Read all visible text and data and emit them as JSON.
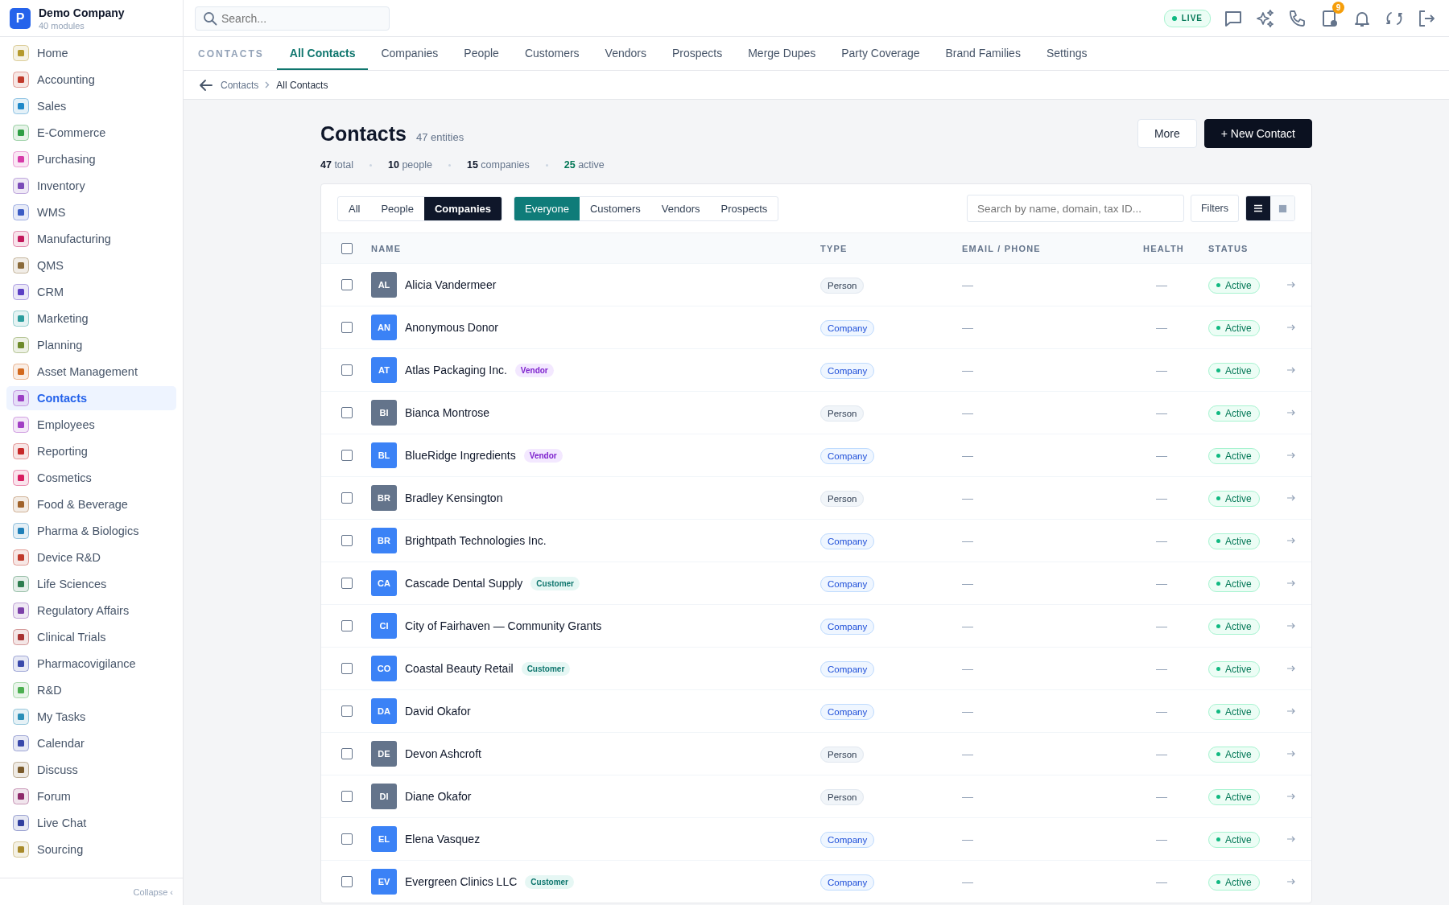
{
  "company": {
    "logo": "P",
    "name": "Demo Company",
    "subtitle": "40 modules"
  },
  "sidebar": {
    "items": [
      {
        "label": "Home",
        "color": "#b59a2e",
        "selected": false
      },
      {
        "label": "Accounting",
        "color": "#c0392b",
        "selected": false
      },
      {
        "label": "Sales",
        "color": "#1e88c8",
        "selected": false
      },
      {
        "label": "E-Commerce",
        "color": "#2e9e44",
        "selected": false
      },
      {
        "label": "Purchasing",
        "color": "#d63aa8",
        "selected": false
      },
      {
        "label": "Inventory",
        "color": "#7b4bb8",
        "selected": false
      },
      {
        "label": "WMS",
        "color": "#3b5cc4",
        "selected": false
      },
      {
        "label": "Manufacturing",
        "color": "#c2185b",
        "selected": false
      },
      {
        "label": "QMS",
        "color": "#8a6a3a",
        "selected": false
      },
      {
        "label": "CRM",
        "color": "#5b3fc4",
        "selected": false
      },
      {
        "label": "Marketing",
        "color": "#2a9d9d",
        "selected": false
      },
      {
        "label": "Planning",
        "color": "#6d8a2a",
        "selected": false
      },
      {
        "label": "Asset Management",
        "color": "#d2691e",
        "selected": false
      },
      {
        "label": "Contacts",
        "color": "#9b3fc4",
        "selected": true
      },
      {
        "label": "Employees",
        "color": "#a23fc4",
        "selected": false
      },
      {
        "label": "Reporting",
        "color": "#c62828",
        "selected": false
      },
      {
        "label": "Cosmetics",
        "color": "#d81b60",
        "selected": false
      },
      {
        "label": "Food & Beverage",
        "color": "#a0622a",
        "selected": false
      },
      {
        "label": "Pharma & Biologics",
        "color": "#1e7fb8",
        "selected": false
      },
      {
        "label": "Device R&D",
        "color": "#c0392b",
        "selected": false
      },
      {
        "label": "Life Sciences",
        "color": "#2e7d4f",
        "selected": false
      },
      {
        "label": "Regulatory Affairs",
        "color": "#7b3fa8",
        "selected": false
      },
      {
        "label": "Clinical Trials",
        "color": "#a83232",
        "selected": false
      },
      {
        "label": "Pharmacovigilance",
        "color": "#3949ab",
        "selected": false
      },
      {
        "label": "R&D",
        "color": "#4caf50",
        "selected": false
      },
      {
        "label": "My Tasks",
        "color": "#2a8fb8",
        "selected": false
      },
      {
        "label": "Calendar",
        "color": "#3949ab",
        "selected": false
      },
      {
        "label": "Discuss",
        "color": "#7a5a2a",
        "selected": false
      },
      {
        "label": "Forum",
        "color": "#8e2a6a",
        "selected": false
      },
      {
        "label": "Live Chat",
        "color": "#303f9f",
        "selected": false
      },
      {
        "label": "Sourcing",
        "color": "#a88a2a",
        "selected": false
      }
    ],
    "collapse": "Collapse ‹"
  },
  "topbar": {
    "search": {
      "placeholder": "Search..."
    },
    "live": "LIVE",
    "badge": "9"
  },
  "module_nav": {
    "title": "CONTACTS",
    "tabs": [
      {
        "label": "All Contacts",
        "selected": true
      },
      {
        "label": "Companies",
        "selected": false
      },
      {
        "label": "People",
        "selected": false
      },
      {
        "label": "Customers",
        "selected": false
      },
      {
        "label": "Vendors",
        "selected": false
      },
      {
        "label": "Prospects",
        "selected": false
      },
      {
        "label": "Merge Dupes",
        "selected": false
      },
      {
        "label": "Party Coverage",
        "selected": false
      },
      {
        "label": "Brand Families",
        "selected": false
      },
      {
        "label": "Settings",
        "selected": false
      }
    ]
  },
  "breadcrumb": [
    "Contacts",
    "All Contacts"
  ],
  "header": {
    "title": "Contacts",
    "count": "47 entities",
    "buttons": [
      "More",
      "+ New Contact"
    ]
  },
  "stats": [
    {
      "value": "47",
      "label": "total",
      "kind": "plain"
    },
    {
      "value": "10",
      "label": "people",
      "kind": "plain"
    },
    {
      "value": "15",
      "label": "companies",
      "kind": "plain"
    },
    {
      "value": "25",
      "label": "active",
      "kind": "good"
    }
  ],
  "filters": {
    "entity": [
      {
        "label": "All",
        "selected": false
      },
      {
        "label": "People",
        "selected": false
      },
      {
        "label": "Companies",
        "selected": true
      }
    ],
    "role": [
      {
        "label": "Everyone",
        "selected": true
      },
      {
        "label": "Customers",
        "selected": false
      },
      {
        "label": "Vendors",
        "selected": false
      },
      {
        "label": "Prospects",
        "selected": false
      }
    ],
    "search": {
      "placeholder": "Search by name, domain, tax ID..."
    },
    "filters_button": "Filters",
    "view": [
      {
        "kind": "list",
        "selected": true
      },
      {
        "kind": "grid",
        "selected": false
      }
    ]
  },
  "table": {
    "select_all": false,
    "columns": [
      "NAME",
      "TYPE",
      "EMAIL / PHONE",
      "HEALTH",
      "STATUS"
    ],
    "rows": [
      {
        "initials": "AL",
        "name": "Alicia Vandermeer",
        "tag": null,
        "type": "Person",
        "kind": "person",
        "email": "—",
        "health": "—",
        "status": "Active",
        "checked": false
      },
      {
        "initials": "AN",
        "name": "Anonymous Donor",
        "tag": null,
        "type": "Company",
        "kind": "company",
        "email": "—",
        "health": "—",
        "status": "Active",
        "checked": false
      },
      {
        "initials": "AT",
        "name": "Atlas Packaging Inc.",
        "tag": {
          "label": "Vendor",
          "kind": "vendor"
        },
        "type": "Company",
        "kind": "company",
        "email": "—",
        "health": "—",
        "status": "Active",
        "checked": false
      },
      {
        "initials": "BI",
        "name": "Bianca Montrose",
        "tag": null,
        "type": "Person",
        "kind": "person",
        "email": "—",
        "health": "—",
        "status": "Active",
        "checked": false
      },
      {
        "initials": "BL",
        "name": "BlueRidge Ingredients",
        "tag": {
          "label": "Vendor",
          "kind": "vendor"
        },
        "type": "Company",
        "kind": "company",
        "email": "—",
        "health": "—",
        "status": "Active",
        "checked": false
      },
      {
        "initials": "BR",
        "name": "Bradley Kensington",
        "tag": null,
        "type": "Person",
        "kind": "person",
        "email": "—",
        "health": "—",
        "status": "Active",
        "checked": false
      },
      {
        "initials": "BR",
        "name": "Brightpath Technologies Inc.",
        "tag": null,
        "type": "Company",
        "kind": "company",
        "email": "—",
        "health": "—",
        "status": "Active",
        "checked": false
      },
      {
        "initials": "CA",
        "name": "Cascade Dental Supply",
        "tag": {
          "label": "Customer",
          "kind": "customer"
        },
        "type": "Company",
        "kind": "company",
        "email": "—",
        "health": "—",
        "status": "Active",
        "checked": false
      },
      {
        "initials": "CI",
        "name": "City of Fairhaven — Community Grants",
        "tag": null,
        "type": "Company",
        "kind": "company",
        "email": "—",
        "health": "—",
        "status": "Active",
        "checked": false
      },
      {
        "initials": "CO",
        "name": "Coastal Beauty Retail",
        "tag": {
          "label": "Customer",
          "kind": "customer"
        },
        "type": "Company",
        "kind": "company",
        "email": "—",
        "health": "—",
        "status": "Active",
        "checked": false
      },
      {
        "initials": "DA",
        "name": "David Okafor",
        "tag": null,
        "type": "Company",
        "kind": "company",
        "email": "—",
        "health": "—",
        "status": "Active",
        "checked": false
      },
      {
        "initials": "DE",
        "name": "Devon Ashcroft",
        "tag": null,
        "type": "Person",
        "kind": "person",
        "email": "—",
        "health": "—",
        "status": "Active",
        "checked": false
      },
      {
        "initials": "DI",
        "name": "Diane Okafor",
        "tag": null,
        "type": "Person",
        "kind": "person",
        "email": "—",
        "health": "—",
        "status": "Active",
        "checked": false
      },
      {
        "initials": "EL",
        "name": "Elena Vasquez",
        "tag": null,
        "type": "Company",
        "kind": "company",
        "email": "—",
        "health": "—",
        "status": "Active",
        "checked": false
      },
      {
        "initials": "EV",
        "name": "Evergreen Clinics LLC",
        "tag": {
          "label": "Customer",
          "kind": "customer"
        },
        "type": "Company",
        "kind": "company",
        "email": "—",
        "health": "—",
        "status": "Active",
        "checked": false
      }
    ]
  }
}
